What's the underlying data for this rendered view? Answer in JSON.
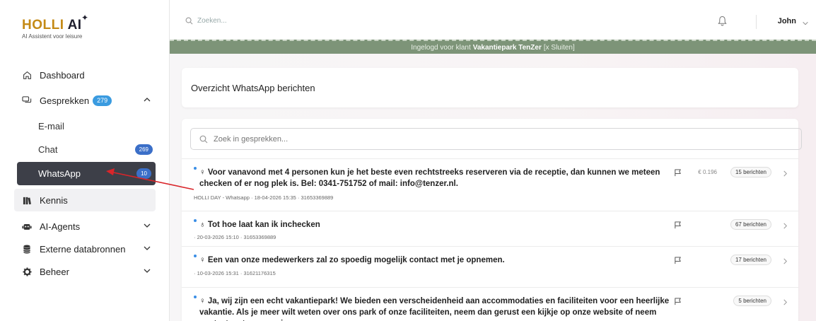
{
  "brand": {
    "name_part1": "HOLLI",
    "name_part2": "AI",
    "tagline": "AI Assistent voor leisure"
  },
  "topbar": {
    "search_placeholder": "Zoeken...",
    "user_name": "John"
  },
  "banner": {
    "prefix": "Ingelogd voor klant",
    "client": "Vakantiepark TenZer",
    "close": "[x Sluiten]"
  },
  "sidebar": {
    "dashboard": "Dashboard",
    "gesprekken": {
      "label": "Gesprekken",
      "badge": "279"
    },
    "sub": {
      "email": "E-mail",
      "chat": {
        "label": "Chat",
        "badge": "269"
      },
      "whatsapp": {
        "label": "WhatsApp",
        "badge": "10"
      }
    },
    "kennis": "Kennis",
    "agents": "AI-Agents",
    "externe": "Externe databronnen",
    "beheer": "Beheer"
  },
  "main": {
    "title": "Overzicht WhatsApp berichten",
    "list_search_placeholder": "Zoek in gesprekken...",
    "rows": [
      {
        "message": "♀ Voor vanavond met 4 personen kun je het beste even rechtstreeks reserveren via de receptie, dan kunnen we meteen checken of er nog plek is. Bel: 0341-751752 of mail: info@tenzer.nl.",
        "meta": "HOLLI DAY - Whatsapp · 18-04-2026 15:35 · 31653369889",
        "cost": "€ 0.196",
        "count": "15 berichten"
      },
      {
        "message": "♁ Tot hoe laat kan ik inchecken",
        "meta": "· 20-03-2026 15:10 · 31653369889",
        "cost": "",
        "count": "67 berichten"
      },
      {
        "message": "♀ Een van onze medewerkers zal zo spoedig mogelijk contact met je opnemen.",
        "meta": "· 10-03-2026 15:31 · 31621176315",
        "cost": "",
        "count": "17 berichten"
      },
      {
        "message": "♀ Ja, wij zijn een echt vakantiepark! We bieden een verscheidenheid aan accommodaties en faciliteiten voor een heerlijke vakantie. Als je meer wilt weten over ons park of onze faciliteiten, neem dan gerust een kijkje op onze website of neem contact met ons op via",
        "meta": "",
        "cost": "",
        "count": "5 berichten"
      }
    ]
  },
  "colors": {
    "brand_gold": "#c48a16",
    "banner_green": "#7d9478",
    "active_nav": "#3d3f48",
    "accent_blue": "#3a8ee6",
    "annotation_red": "#d9252a"
  }
}
